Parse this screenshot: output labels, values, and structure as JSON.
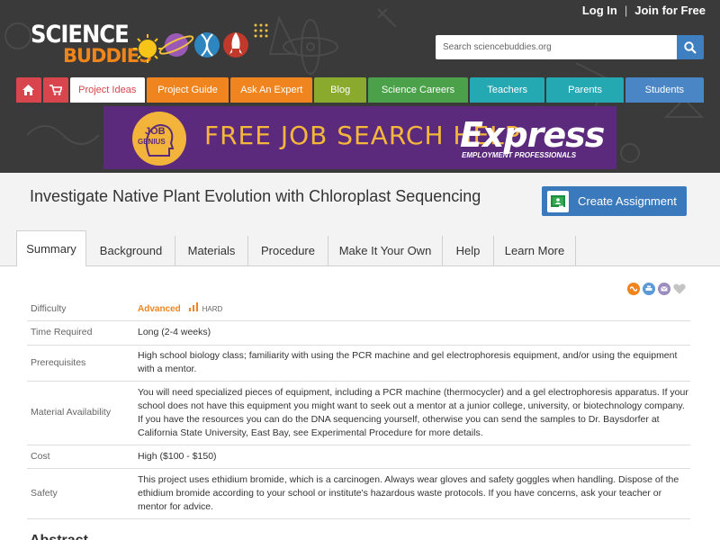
{
  "brand": {
    "line1": "SCIENCE",
    "line2": "BUDDIES",
    "tm": "®"
  },
  "top_links": {
    "login": "Log In",
    "separator": "|",
    "join": "Join for Free"
  },
  "search": {
    "placeholder": "Search sciencebuddies.org",
    "icon": "search-icon"
  },
  "nav": {
    "home_icon": "home-icon",
    "cart_icon": "cart-icon",
    "items": [
      "Project Ideas",
      "Project Guide",
      "Ask An Expert",
      "Blog",
      "Science Careers",
      "Teachers",
      "Parents",
      "Students"
    ],
    "active": "Project Ideas"
  },
  "banner": {
    "badge_line1": "JOB",
    "badge_line2": "GENIUS",
    "headline": "FREE JOB SEARCH HELP",
    "brand": "Express",
    "brand_sub": "EMPLOYMENT PROFESSIONALS"
  },
  "page": {
    "title": "Investigate Native Plant Evolution with Chloroplast Sequencing",
    "create_assignment": "Create Assignment"
  },
  "tabs": [
    "Summary",
    "Background",
    "Materials",
    "Procedure",
    "Make It Your Own",
    "Help",
    "Learn More"
  ],
  "active_tab": "Summary",
  "share_icons": [
    "share-icon",
    "print-icon",
    "email-icon",
    "favorite-heart-icon"
  ],
  "details": {
    "difficulty_label": "Difficulty",
    "difficulty_value": "Advanced",
    "difficulty_level": "HARD",
    "time_label": "Time Required",
    "time_value": "Long (2-4 weeks)",
    "prereq_label": "Prerequisites",
    "prereq_value": "High school biology class; familiarity with using the PCR machine and gel electrophoresis equipment, and/or using the equipment with a mentor.",
    "material_label": "Material Availability",
    "material_value": "You will need specialized pieces of equipment, including a PCR machine (thermocycler) and a gel electrophoresis apparatus. If your school does not have this equipment you might want to seek out a mentor at a junior college, university, or biotechnology company. If you have the resources you can do the DNA sequencing yourself, otherwise you can send the samples to Dr. Baysdorfer at California State University, East Bay, see Experimental Procedure for more details.",
    "cost_label": "Cost",
    "cost_value": "High ($100 - $150)",
    "safety_label": "Safety",
    "safety_value": "This project uses ethidium bromide, which is a carcinogen. Always wear gloves and safety goggles when handling. Dispose of the ethidium bromide according to your school or institute's hazardous waste protocols. If you have concerns, ask your teacher or mentor for advice."
  },
  "abstract_heading": "Abstract",
  "colors": {
    "header_bg": "#3a3a3a",
    "brand_orange": "#f08520",
    "nav_red": "#d9454c",
    "nav_green": "#4aa14a",
    "nav_teal": "#24a8b2",
    "nav_blue": "#4a85c6",
    "banner_purple": "#5c2a7c",
    "button_blue": "#3b79bd"
  }
}
